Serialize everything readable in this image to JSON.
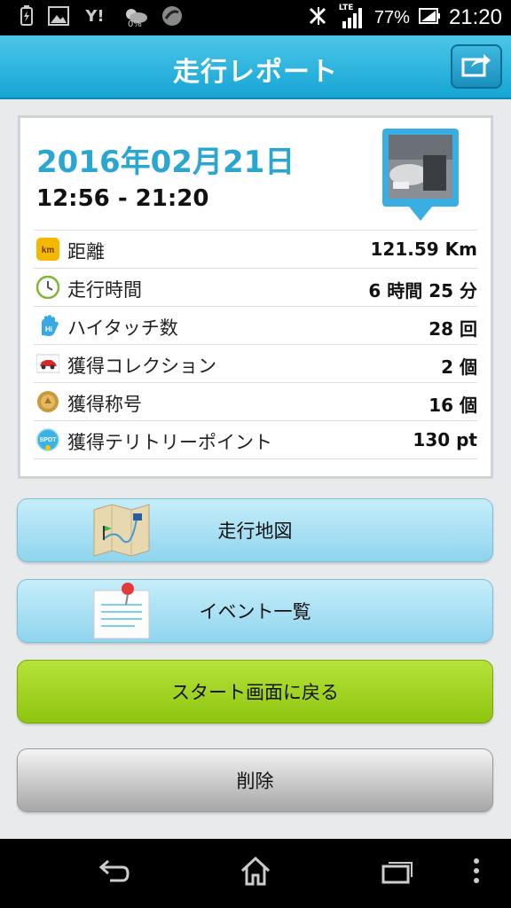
{
  "status_bar": {
    "icons": [
      "charging-icon",
      "gallery-icon",
      "yahoo-icon",
      "weather-icon",
      "app-icon"
    ],
    "weather_percent": "0%",
    "carrier_label": "Y!",
    "battery_text": "77%",
    "network_label": "LTE",
    "time": "21:20"
  },
  "app_bar": {
    "title": "走行レポート",
    "share_icon": "share-icon"
  },
  "report": {
    "date": "2016年02月21日",
    "time_range": "12:56 - 21:20",
    "rows": [
      {
        "icon": "km-icon",
        "icon_text": "km",
        "label": "距離",
        "value": "121.59 Km"
      },
      {
        "icon": "clock-icon",
        "label": "走行時間",
        "value": "6 時間 25 分"
      },
      {
        "icon": "hi-touch-icon",
        "label": "ハイタッチ数",
        "value": "28 回"
      },
      {
        "icon": "car-icon",
        "label": "獲得コレクション",
        "value": "2 個"
      },
      {
        "icon": "medal-icon",
        "label": "獲得称号",
        "value": "16 個"
      },
      {
        "icon": "spot-icon",
        "icon_text": "SPOT",
        "label": "獲得テリトリーポイント",
        "value": "130 pt"
      }
    ]
  },
  "buttons": {
    "map": "走行地図",
    "events": "イベント一覧",
    "back_to_start": "スタート画面に戻る",
    "delete": "削除"
  },
  "colors": {
    "accent": "#2ba6d1",
    "appbar": "#16a5d3",
    "green_button": "#9acd1c"
  }
}
